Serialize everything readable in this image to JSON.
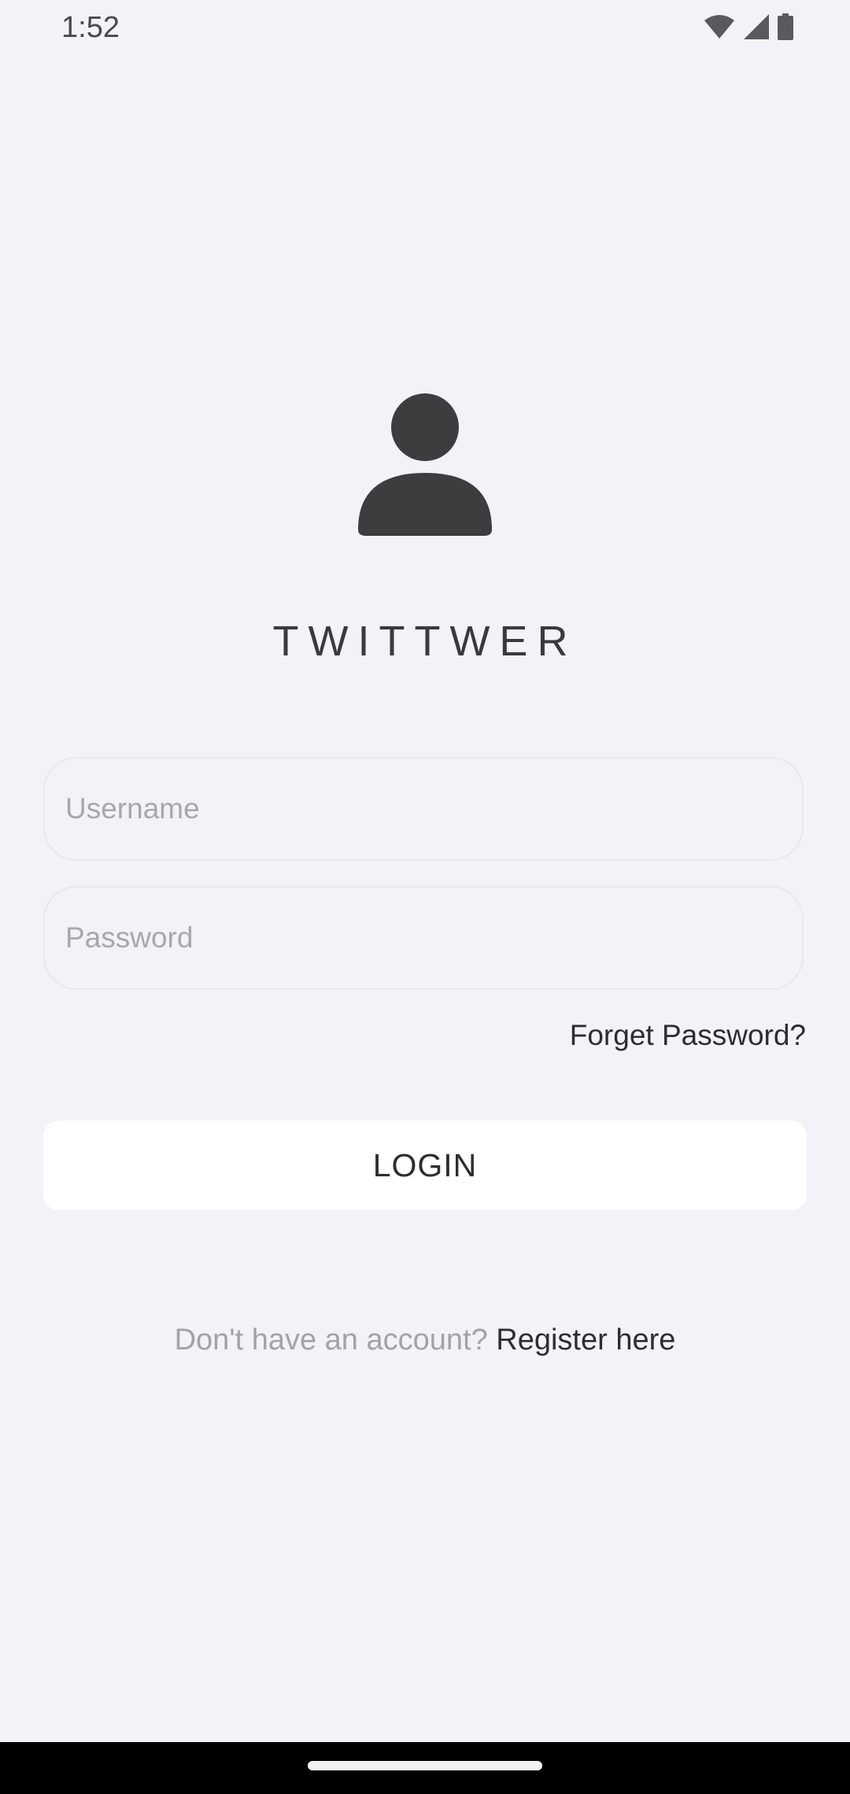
{
  "status_bar": {
    "time": "1:52",
    "icons": [
      "wifi-icon",
      "cellular-signal-icon",
      "battery-icon"
    ]
  },
  "app": {
    "title": "TWITTWER",
    "logo_icon": "person-icon"
  },
  "login_form": {
    "username_placeholder": "Username",
    "username_value": "",
    "password_placeholder": "Password",
    "password_value": "",
    "forgot_password_label": "Forget Password?",
    "login_label": "LOGIN"
  },
  "register": {
    "prompt": "Don't have an account?",
    "link_label": "Register here"
  },
  "colors": {
    "background": "#f2f3f8",
    "icon": "#3d3d3f",
    "button_bg": "#ffffff",
    "placeholder": "#a7a7ad"
  }
}
